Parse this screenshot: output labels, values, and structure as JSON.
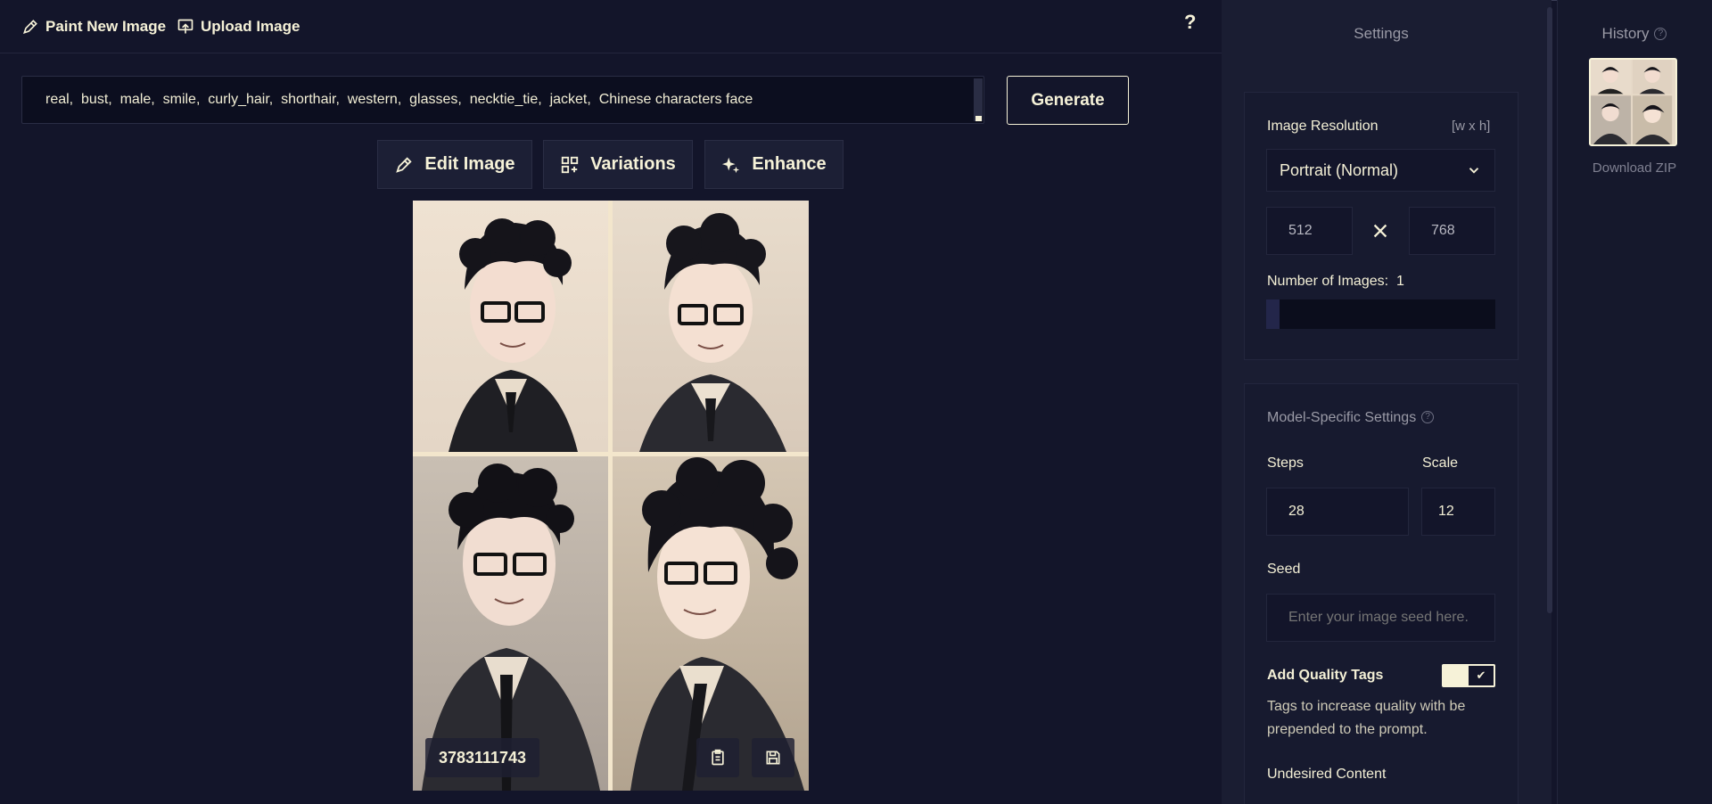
{
  "topbar": {
    "paint_label": "Paint New Image",
    "upload_label": "Upload Image",
    "help_label": "?"
  },
  "prompt": {
    "value": "real,  bust,  male,  smile,  curly_hair,  shorthair,  western,  glasses,  necktie_tie,  jacket,  Chinese characters face"
  },
  "generate_label": "Generate",
  "tools": {
    "edit_label": "Edit Image",
    "variations_label": "Variations",
    "enhance_label": "Enhance"
  },
  "image": {
    "seed": "3783111743",
    "copy_icon": "clipboard-icon",
    "save_icon": "save-icon"
  },
  "settings": {
    "title": "Settings",
    "resolution": {
      "label": "Image Resolution",
      "hint": "[w x h]",
      "preset": "Portrait (Normal)",
      "width": "512",
      "height": "768"
    },
    "num_images": {
      "label": "Number of Images:",
      "value": "1",
      "fill_fraction": 0.06
    },
    "model": {
      "label": "Model-Specific Settings",
      "steps_label": "Steps",
      "steps_value": "28",
      "scale_label": "Scale",
      "scale_value": "12",
      "seed_label": "Seed",
      "seed_placeholder": "Enter your image seed here.",
      "quality_label": "Add Quality Tags",
      "quality_on": true,
      "quality_desc": "Tags to increase quality with be prepended to the prompt.",
      "undesired_label": "Undesired Content"
    }
  },
  "history": {
    "title": "History",
    "download_label": "Download ZIP"
  },
  "colors": {
    "background": "#13152a",
    "panel": "#1a1d32",
    "accent": "#f6f2d8",
    "muted": "#9a9aa6"
  }
}
